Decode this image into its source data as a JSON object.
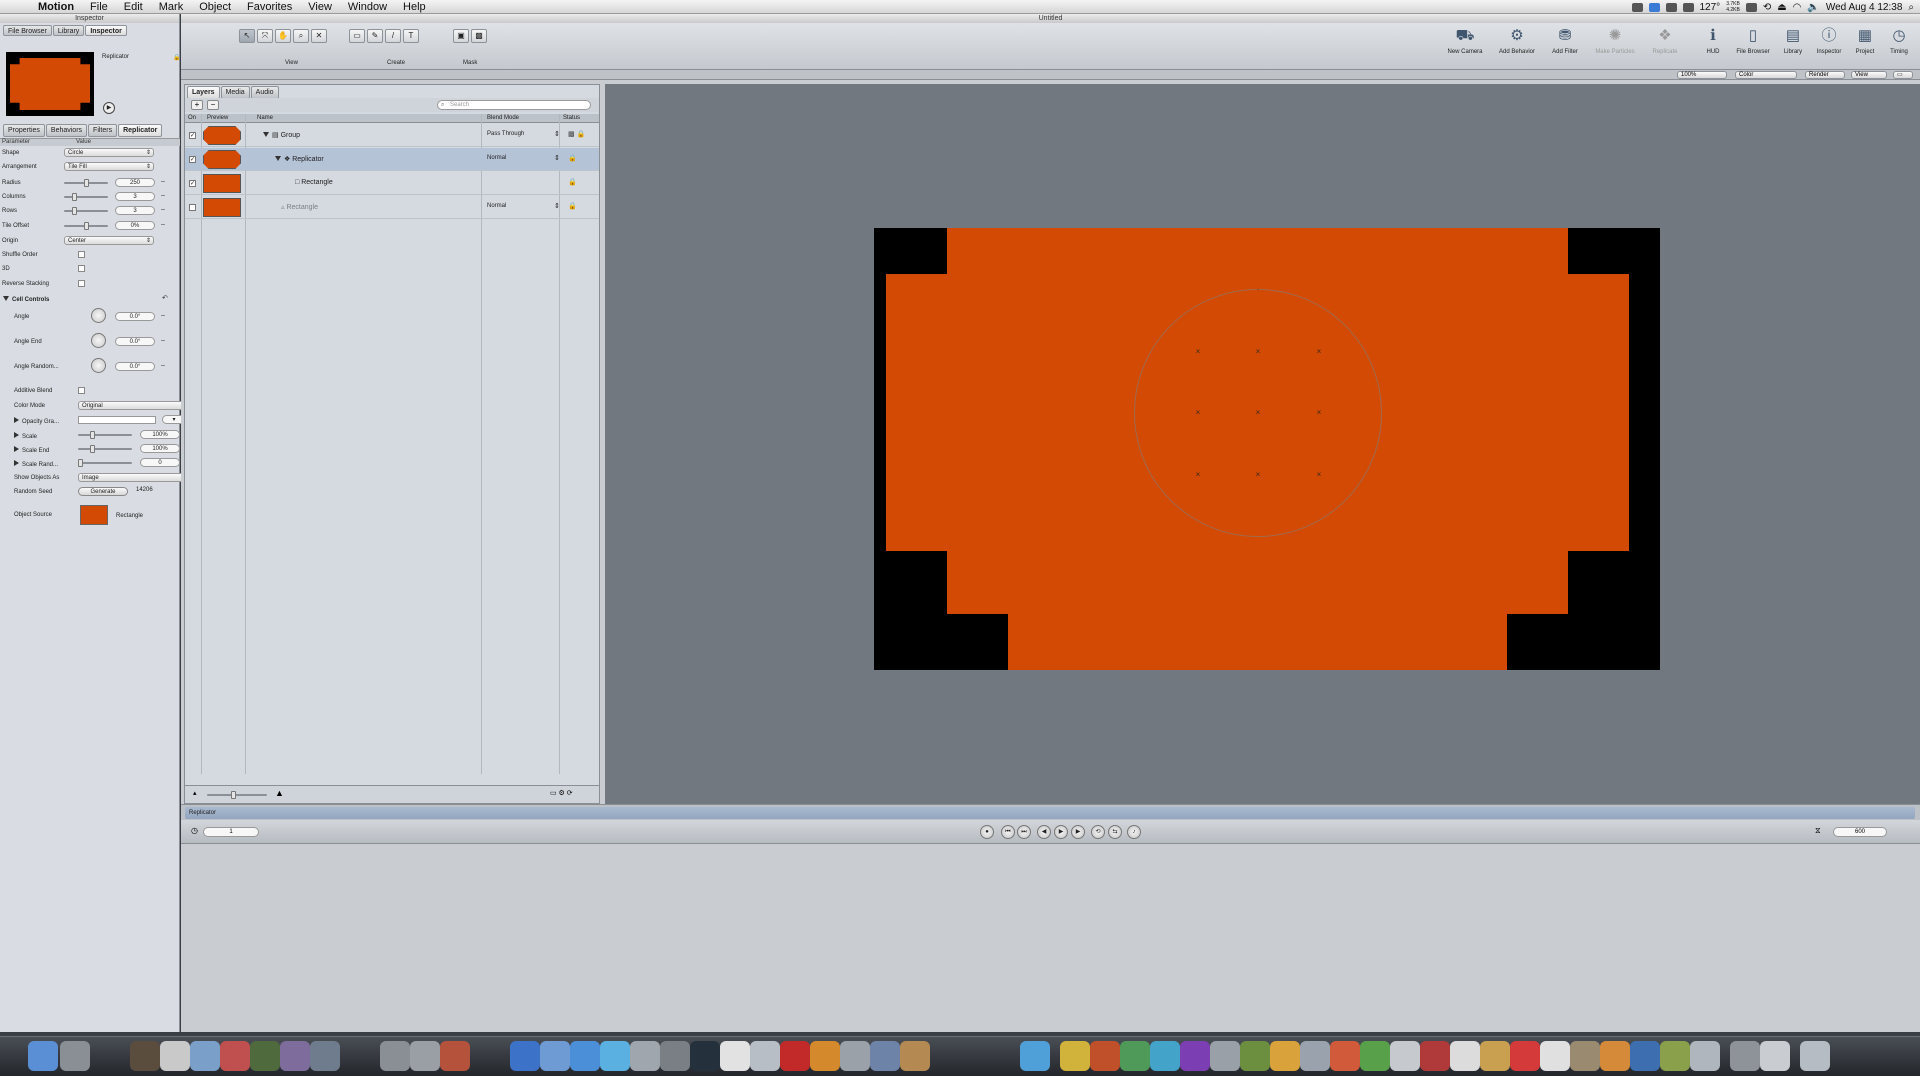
{
  "menubar": {
    "app": "Motion",
    "items": [
      "File",
      "Edit",
      "Mark",
      "Object",
      "Favorites",
      "View",
      "Window",
      "Help"
    ],
    "status": {
      "zoom": "127°",
      "mem_top": "3.7KB",
      "mem_bottom": "4.2KB",
      "clock": "Wed Aug 4  12:38"
    }
  },
  "inspector": {
    "title": "Inspector",
    "tabs": [
      "File Browser",
      "Library",
      "Inspector"
    ],
    "preview_name": "Replicator",
    "subtabs": [
      "Properties",
      "Behaviors",
      "Filters",
      "Replicator"
    ],
    "col_parameter": "Parameter",
    "col_value": "Value",
    "params": {
      "shape": {
        "label": "Shape",
        "value": "Circle"
      },
      "arrangement": {
        "label": "Arrangement",
        "value": "Tile Fill"
      },
      "radius": {
        "label": "Radius",
        "value": "250"
      },
      "columns": {
        "label": "Columns",
        "value": "3"
      },
      "rows": {
        "label": "Rows",
        "value": "3"
      },
      "tile_offset": {
        "label": "Tile Offset",
        "value": "0%"
      },
      "origin": {
        "label": "Origin",
        "value": "Center"
      },
      "shuffle_order": {
        "label": "Shuffle Order"
      },
      "three_d": {
        "label": "3D"
      },
      "reverse_stacking": {
        "label": "Reverse Stacking"
      },
      "cell_controls": {
        "label": "Cell Controls"
      },
      "angle": {
        "label": "Angle",
        "value": "0.0°"
      },
      "angle_end": {
        "label": "Angle End",
        "value": "0.0°"
      },
      "angle_random": {
        "label": "Angle Random...",
        "value": "0.0°"
      },
      "additive_blend": {
        "label": "Additive Blend"
      },
      "color_mode": {
        "label": "Color Mode",
        "value": "Original"
      },
      "opacity_gradient": {
        "label": "Opacity Gra..."
      },
      "scale": {
        "label": "Scale",
        "value": "100%"
      },
      "scale_end": {
        "label": "Scale End",
        "value": "100%"
      },
      "scale_random": {
        "label": "Scale Rand...",
        "value": "0"
      },
      "show_objects_as": {
        "label": "Show Objects As",
        "value": "Image"
      },
      "random_seed": {
        "label": "Random Seed",
        "button": "Generate",
        "value": "14206"
      },
      "object_source": {
        "label": "Object Source",
        "value": "Rectangle"
      }
    }
  },
  "main": {
    "title": "Untitled",
    "toolbar_groups": {
      "view": "View",
      "create": "Create",
      "mask": "Mask"
    },
    "right_tools": [
      "New Camera",
      "Add Behavior",
      "Add Filter",
      "Make Particles",
      "Replicate",
      "HUD",
      "File Browser",
      "Library",
      "Inspector",
      "Project",
      "Timing"
    ],
    "view_popups": {
      "zoom": "100%",
      "channels": "Color",
      "render": "Render",
      "view": "View"
    }
  },
  "layers": {
    "tabs": [
      "Layers",
      "Media",
      "Audio"
    ],
    "search_placeholder": "Search",
    "columns": {
      "on": "On",
      "preview": "Preview",
      "name": "Name",
      "blend": "Blend Mode",
      "status": "Status"
    },
    "rows": [
      {
        "name": "Group",
        "blend": "Pass Through"
      },
      {
        "name": "Replicator",
        "blend": "Normal"
      },
      {
        "name": "Rectangle",
        "blend": ""
      },
      {
        "name": "Rectangle",
        "blend": "Normal"
      }
    ]
  },
  "timeline": {
    "track_name": "Replicator",
    "current_frame": "1",
    "end_frame": "600"
  },
  "colors": {
    "accent": "#d34a04",
    "canvas": "#727880",
    "selection": "#b4c3d6"
  }
}
